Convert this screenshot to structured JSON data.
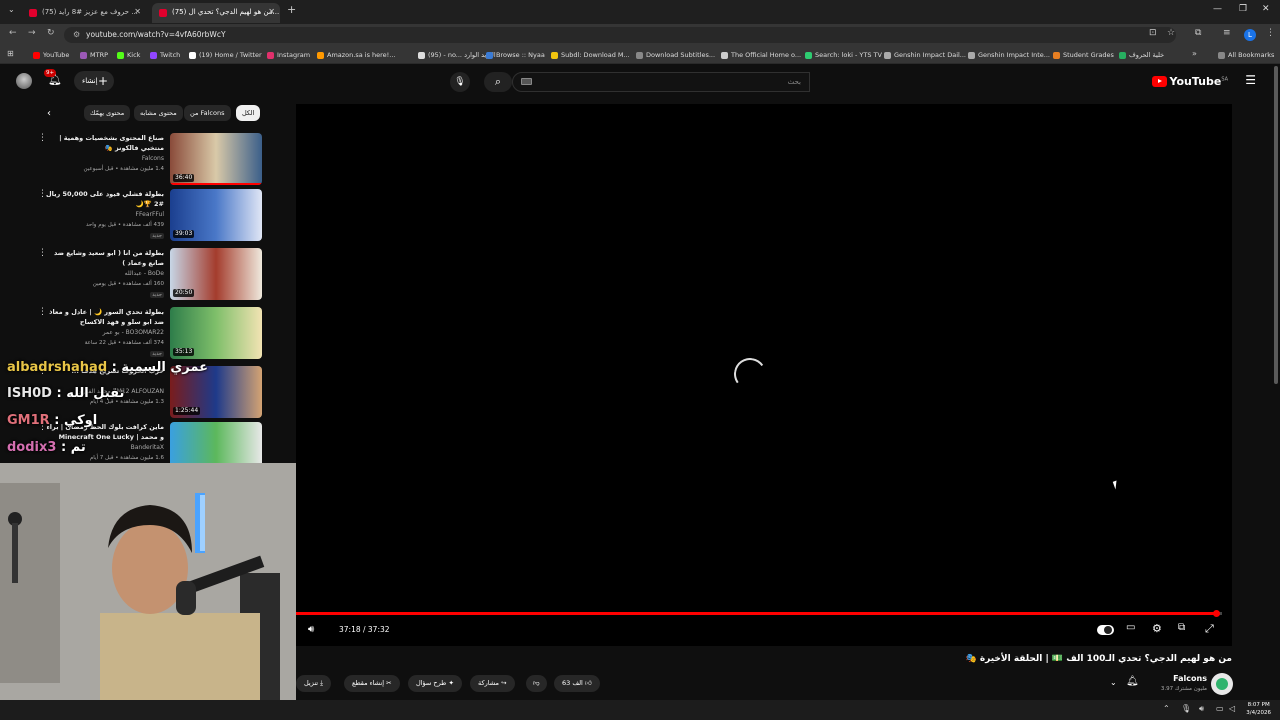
{
  "browser": {
    "tabs": [
      {
        "label": "(75) حروف مع عزيز #8 رايد ...",
        "active": false
      },
      {
        "label": "(75) من هو لهيم الدجي؟ تحدي ال...",
        "active": true
      }
    ],
    "new_tab": "+",
    "url": "youtube.com/watch?v=4vfA60rbWcY",
    "bookmarks": [
      {
        "label": "YouTube",
        "color": "#ff0000"
      },
      {
        "label": "MTRP",
        "color": "#9b59b6"
      },
      {
        "label": "Kick",
        "color": "#53fc18"
      },
      {
        "label": "Twitch",
        "color": "#9146ff"
      },
      {
        "label": "(19) Home / Twitter",
        "color": "#ffffff"
      },
      {
        "label": "Instagram",
        "color": "#e1306c"
      },
      {
        "label": "Amazon.sa is here!...",
        "color": "#ff9900"
      },
      {
        "label": "(95) - no... البريد الوارد",
        "color": "#dddddd"
      },
      {
        "label": "Browse :: Nyaa",
        "color": "#3a7bd5"
      },
      {
        "label": "Subdl: Download M...",
        "color": "#f1c40f"
      },
      {
        "label": "Download Subtitles...",
        "color": "#888888"
      },
      {
        "label": "The Official Home o...",
        "color": "#cccccc"
      },
      {
        "label": "Search: loki - YTS TV",
        "color": "#2ecc71"
      },
      {
        "label": "Genshin Impact Dail...",
        "color": "#aaaaaa"
      },
      {
        "label": "Genshin Impact Inte...",
        "color": "#aaaaaa"
      },
      {
        "label": "Student Grades",
        "color": "#e67e22"
      },
      {
        "label": "خلية الحروف",
        "color": "#27ae60"
      }
    ],
    "all_bookmarks": "All Bookmarks",
    "profile_initial": "L"
  },
  "youtube": {
    "logo": "YouTube",
    "logo_region": "SA",
    "search_placeholder": "بحث",
    "create_label": "إنشاء",
    "notif_count": "9+",
    "chips": [
      "الكل",
      "من Falcons",
      "محتوى مشابه",
      "محتوى يهمّك"
    ],
    "related": [
      {
        "title": "صناع المحتوى بشخصيات وهمية | منتخبي فالكونز 🎭",
        "channel": "Falcons",
        "meta": "1.4 مليون مشاهدة • قبل أسبوعين",
        "duration": "36:40",
        "progress": 1.0,
        "colors": [
          "#8a4b3a",
          "#d9c9a8",
          "#3b5f8a"
        ]
      },
      {
        "title": "بطولة فشلي فيود على 50,000 ريال #2 🏆🌙",
        "channel": "FFearFFul",
        "meta": "439 ألف مشاهدة • قبل يوم واحد",
        "duration": "39:03",
        "progress": 0,
        "new": "جديد",
        "colors": [
          "#1b3f8f",
          "#4a78c8",
          "#e0e6f5"
        ]
      },
      {
        "title": "بطولة من انا ( ابو سعيد وشايع ضد صانع وعماد )",
        "channel": "BoDe - عبدالله",
        "meta": "160 ألف مشاهدة • قبل يومين",
        "duration": "20:50",
        "progress": 0,
        "new": "جديد",
        "colors": [
          "#c7d6e6",
          "#a43c2d",
          "#efe9dd"
        ]
      },
      {
        "title": "بطولة تحدي السور 🌙 | عادل و معاذ ضد ابو سلو و فهد الاكساح",
        "channel": "BO3OMAR22 - بو عمر",
        "meta": "374 ألف مشاهدة • قبل 22 ساعة",
        "duration": "35:13",
        "progress": 0,
        "new": "جديد",
        "colors": [
          "#2e7d4a",
          "#7fbf6a",
          "#f2e3b3"
        ]
      },
      {
        "title": "حرب الحروف تصريح هدف ...",
        "channel": "M12 ALFOUZAN - محمد الفوزان",
        "meta": "1.3 مليون مشاهدة • قبل 4 أيام",
        "duration": "1:25:44",
        "progress": 0,
        "colors": [
          "#7a1c1c",
          "#1e3a8a",
          "#d4a373"
        ]
      },
      {
        "title": "ماين كرافت بلوك الحظ رمضان | براء و محمد | Minecraft One Lucky",
        "channel": "BanderitaX",
        "meta": "1.6 مليون مشاهدة • قبل 7 أيام",
        "duration": "",
        "progress": 0,
        "colors": [
          "#3aa0e0",
          "#5cb85c",
          "#e8e8e8"
        ]
      }
    ],
    "chat": [
      {
        "name": "albadrshahad",
        "message": ": عمري السمية",
        "color": "#e8c547"
      },
      {
        "name": "ISH0D",
        "message": ": تقبل الله",
        "color": "#e8e8e8"
      },
      {
        "name": "GM1R",
        "message": ": اوكي",
        "color": "#e0707a"
      },
      {
        "name": "dodix3",
        "message": ": تم",
        "color": "#d46fb0"
      }
    ],
    "player": {
      "time_current": "37:18",
      "time_total": "37:32",
      "time_display": "37:18 / 37:32",
      "progress": 0.9938
    },
    "video": {
      "title": "من هو لهيم الدجي؟ تحدي الـ100 الف 💵 | الحلقة الأخيرة 🎭",
      "channel": "Falcons",
      "subs": "3.97 مليون مشترك",
      "likes": "63 الف",
      "share": "مشاركة",
      "ask": "طرح سؤال",
      "clip": "إنشاء مقطع",
      "download": "تنزيل"
    }
  },
  "taskbar": {
    "time": "8:07 PM",
    "date": "3/4/2026"
  }
}
